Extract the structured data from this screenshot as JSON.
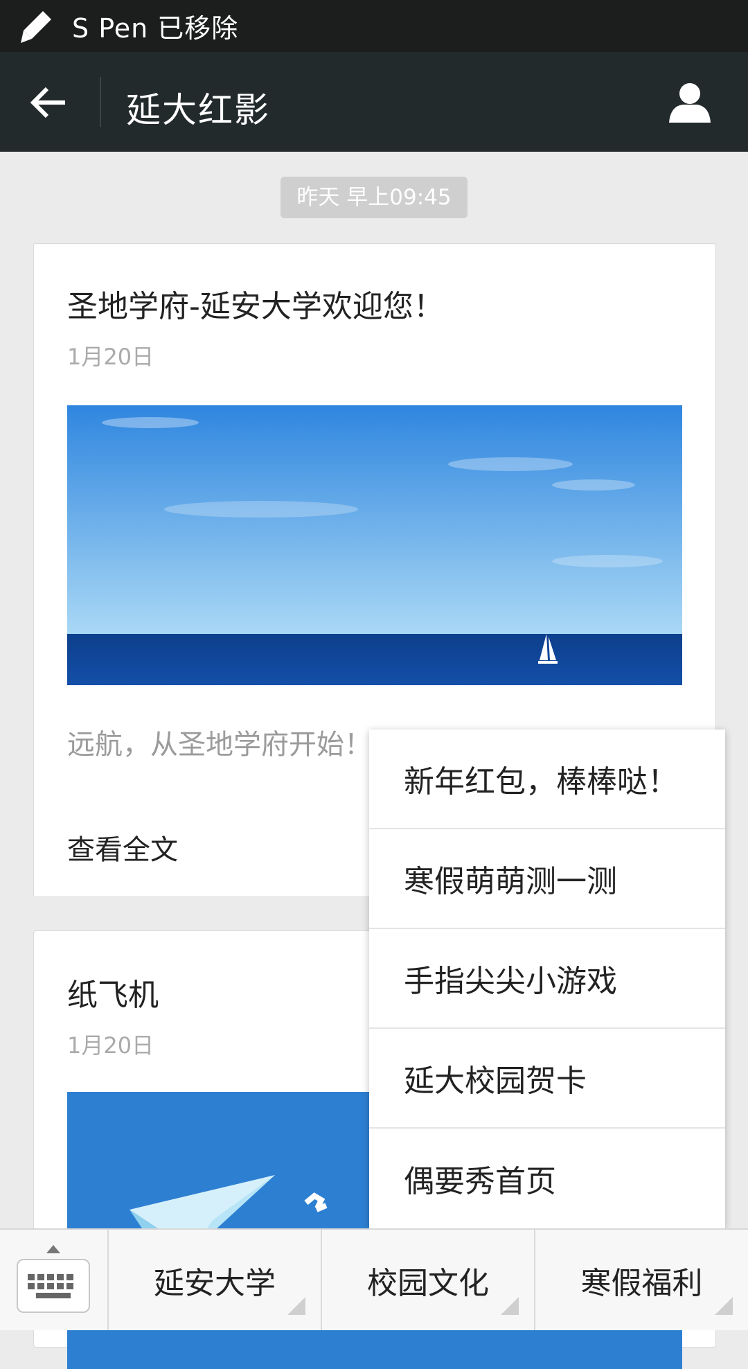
{
  "status_bar": {
    "pen_icon": "pen-icon",
    "text": "S Pen 已移除"
  },
  "header": {
    "back_icon": "arrow-left-icon",
    "title": "延大红影",
    "profile_icon": "user-icon"
  },
  "timestamp": "昨天 早上09:45",
  "articles": [
    {
      "title": "圣地学府-延安大学欢迎您！",
      "date": "1月20日",
      "summary": "远航，从圣地学府开始！",
      "read_more": "查看全文"
    },
    {
      "title": "纸飞机",
      "date": "1月20日"
    }
  ],
  "popup_menu": {
    "items": [
      "新年红包，棒棒哒！",
      "寒假萌萌测一测",
      "手指尖尖小游戏",
      "延大校园贺卡",
      "偶要秀首页"
    ]
  },
  "bottom_bar": {
    "keyboard_icon": "keyboard-icon",
    "tabs": [
      "延安大学",
      "校园文化",
      "寒假福利"
    ]
  },
  "colors": {
    "header_bg": "#232a2c",
    "status_bg": "#1c1d1d",
    "page_bg": "#ebebeb"
  }
}
